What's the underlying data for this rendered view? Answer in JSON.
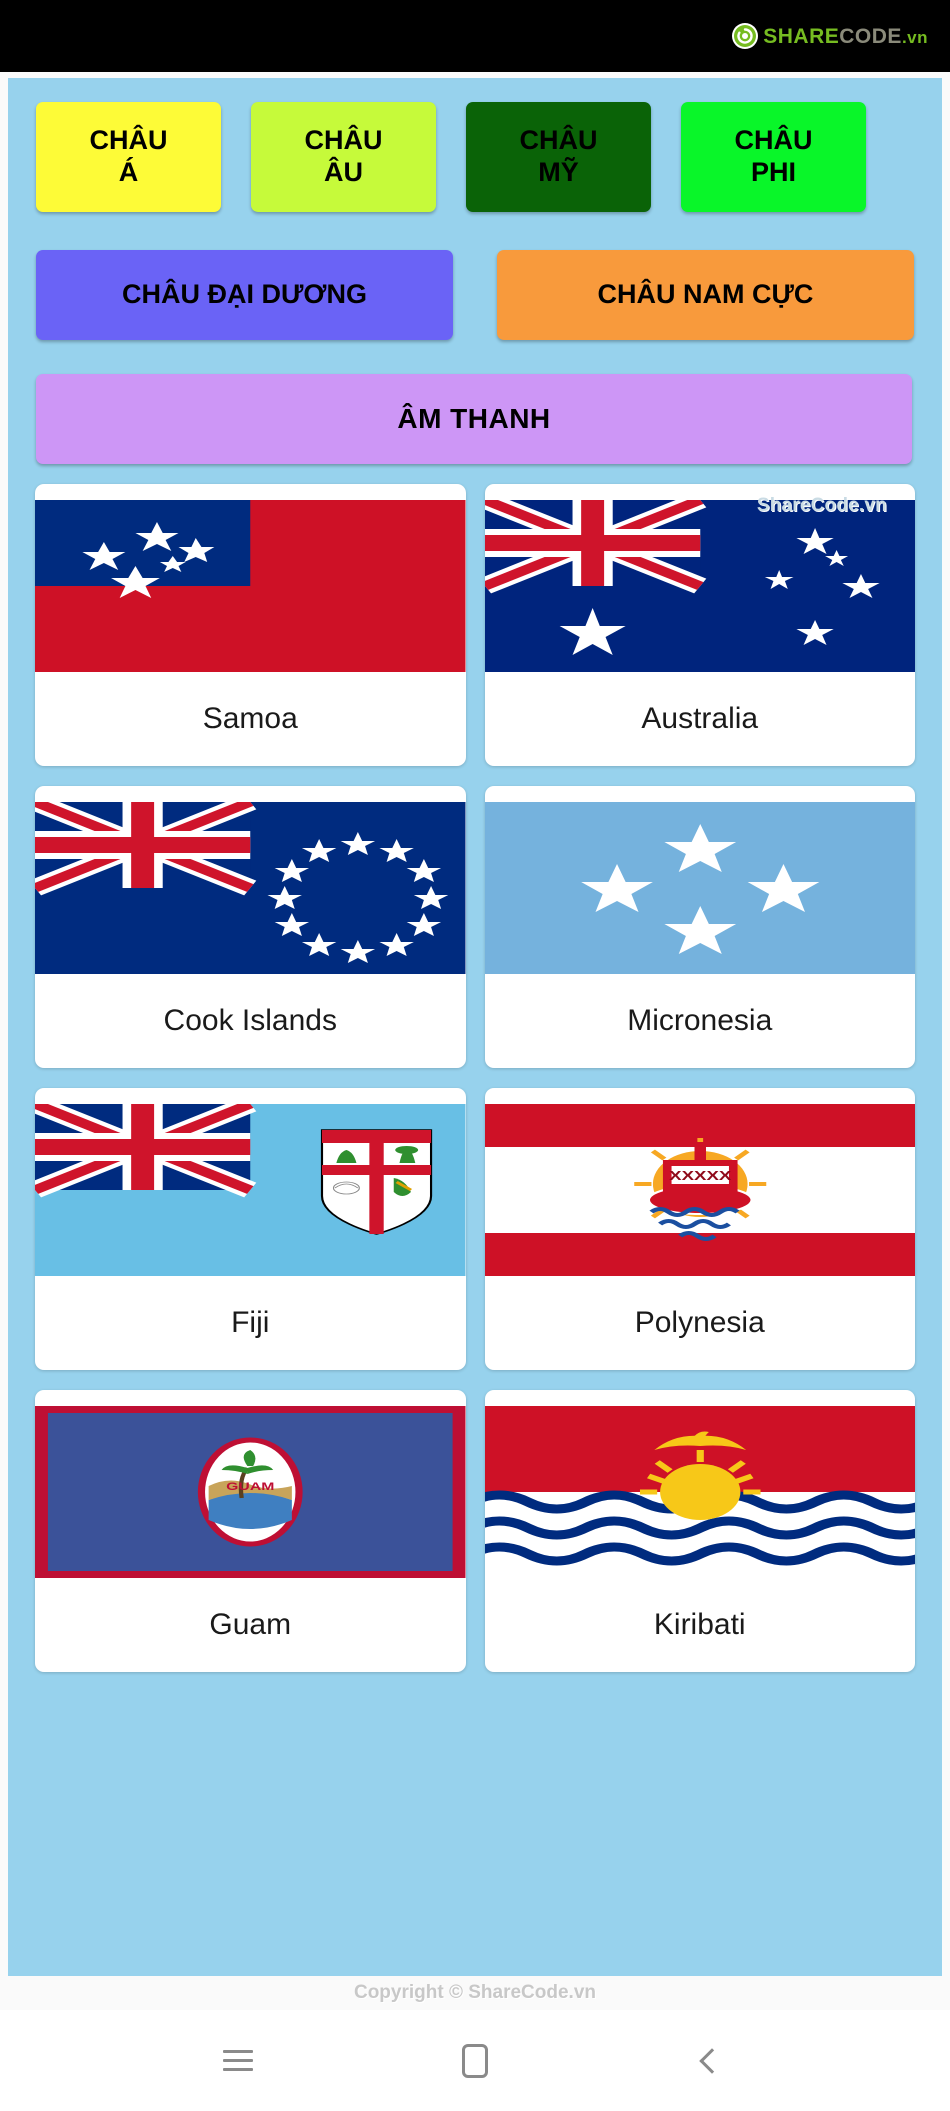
{
  "topbar": {
    "logo_icon": "sharecode-logo-icon",
    "logo_share": "SHARE",
    "logo_code": "CODE",
    "logo_vn": ".vn"
  },
  "continent_buttons": [
    {
      "label": "CHÂU\nÁ",
      "color": "#fdfb37",
      "size": "small"
    },
    {
      "label": "CHÂU\nÂU",
      "color": "#c6fa3a",
      "size": "small"
    },
    {
      "label": "CHÂU\nMỸ",
      "color": "#0a6307",
      "size": "small"
    },
    {
      "label": "CHÂU\nPHI",
      "color": "#09f629",
      "size": "small"
    },
    {
      "label": "CHÂU ĐẠI DƯƠNG",
      "color": "#6a63f6",
      "size": "wide"
    },
    {
      "label": "CHÂU NAM CỰC",
      "color": "#f89a3c",
      "size": "wide"
    },
    {
      "label": "ÂM THANH",
      "color": "#cd96f6",
      "size": "full"
    }
  ],
  "watermark_middle": "ShareCode.vn",
  "flags": [
    {
      "name": "Samoa",
      "flag_id": "flag-samoa"
    },
    {
      "name": "Australia",
      "flag_id": "flag-australia"
    },
    {
      "name": "Cook Islands",
      "flag_id": "flag-cook-islands"
    },
    {
      "name": "Micronesia",
      "flag_id": "flag-micronesia"
    },
    {
      "name": "Fiji",
      "flag_id": "flag-fiji"
    },
    {
      "name": "Polynesia",
      "flag_id": "flag-polynesia"
    },
    {
      "name": "Guam",
      "flag_id": "flag-guam"
    },
    {
      "name": "Kiribati",
      "flag_id": "flag-kiribati"
    }
  ],
  "footer": {
    "copyright": "Copyright © ShareCode.vn",
    "nav": [
      {
        "icon": "menu-icon"
      },
      {
        "icon": "home-icon"
      },
      {
        "icon": "back-icon"
      }
    ]
  },
  "colors": {
    "app_background": "#97d2ed",
    "topbar": "#000000",
    "card": "#ffffff"
  }
}
